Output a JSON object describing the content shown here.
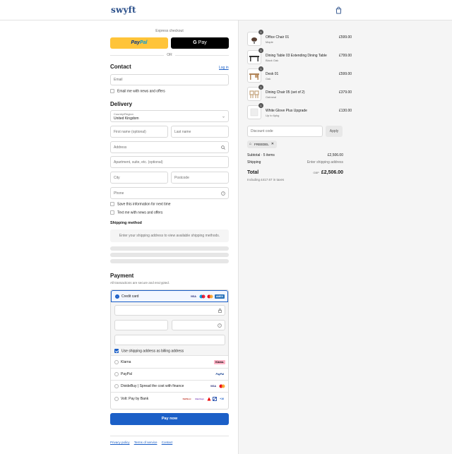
{
  "header": {
    "logo": "swyft",
    "bag_icon": "shopping-bag-icon"
  },
  "express": {
    "label": "Express checkout",
    "paypal_a": "Pay",
    "paypal_b": "Pal",
    "gpay_g": "G",
    "gpay_label": "Pay",
    "or": "OR"
  },
  "contact": {
    "title": "Contact",
    "login": "Log in",
    "email_placeholder": "Email",
    "news_label": "Email me with news and offers"
  },
  "delivery": {
    "title": "Delivery",
    "country_label": "Country/Region",
    "country_value": "United Kingdom",
    "first_name": "First name (optional)",
    "last_name": "Last name",
    "address": "Address",
    "apartment": "Apartment, suite, etc. (optional)",
    "city": "City",
    "postcode": "Postcode",
    "phone": "Phone",
    "save_info": "Save this information for next time",
    "text_me": "Text me with news and offers"
  },
  "shipping": {
    "title": "Shipping method",
    "note": "Enter your shipping address to view available shipping methods."
  },
  "payment": {
    "title": "Payment",
    "subtitle": "All transactions are secure and encrypted.",
    "credit_card": "Credit card",
    "billing_same": "Use shipping address as billing address",
    "klarna": "Klarna",
    "paypal": "PayPal",
    "dividebuy": "DivideBuy | Spread the cost with finance",
    "volt": "Volt: Pay by Bank",
    "logos": {
      "visa": "VISA",
      "amex": "AMEX",
      "klarna": "Klarna.",
      "paypal": "PayPal",
      "vc": "VISA",
      "vb1": "NatWest",
      "vb2": "Barclays",
      "vb3": "Santander",
      "vb4": "Revolut",
      "vb5": "+16"
    },
    "pay_now": "Pay now"
  },
  "footer": {
    "privacy": "Privacy policy",
    "terms": "Terms of service",
    "contact": "Contact"
  },
  "summary": {
    "items": [
      {
        "qty": "1",
        "name": "Office Chair 01",
        "variant": "Maple",
        "price": "£599.00"
      },
      {
        "qty": "1",
        "name": "Dining Table 03 Extending Dining Table",
        "variant": "Black Oak",
        "price": "£799.00"
      },
      {
        "qty": "1",
        "name": "Desk 01",
        "variant": "Oak",
        "price": "£599.00"
      },
      {
        "qty": "1",
        "name": "Dining Chair 05 (set of 2)",
        "variant": "Oatmeal",
        "price": "£379.00"
      },
      {
        "qty": "1",
        "name": "White Glove Plus Upgrade",
        "variant": "Up to 6pkg",
        "price": "£130.00"
      }
    ],
    "discount_placeholder": "Discount code",
    "apply": "Apply",
    "code": "FREEDEL",
    "subtotal_label": "Subtotal · 5 items",
    "subtotal_value": "£2,506.00",
    "shipping_label": "Shipping",
    "shipping_value": "Enter shipping address",
    "total_label": "Total",
    "currency": "GBP",
    "total_value": "£2,506.00",
    "taxes": "Including £417.67 in taxes"
  }
}
